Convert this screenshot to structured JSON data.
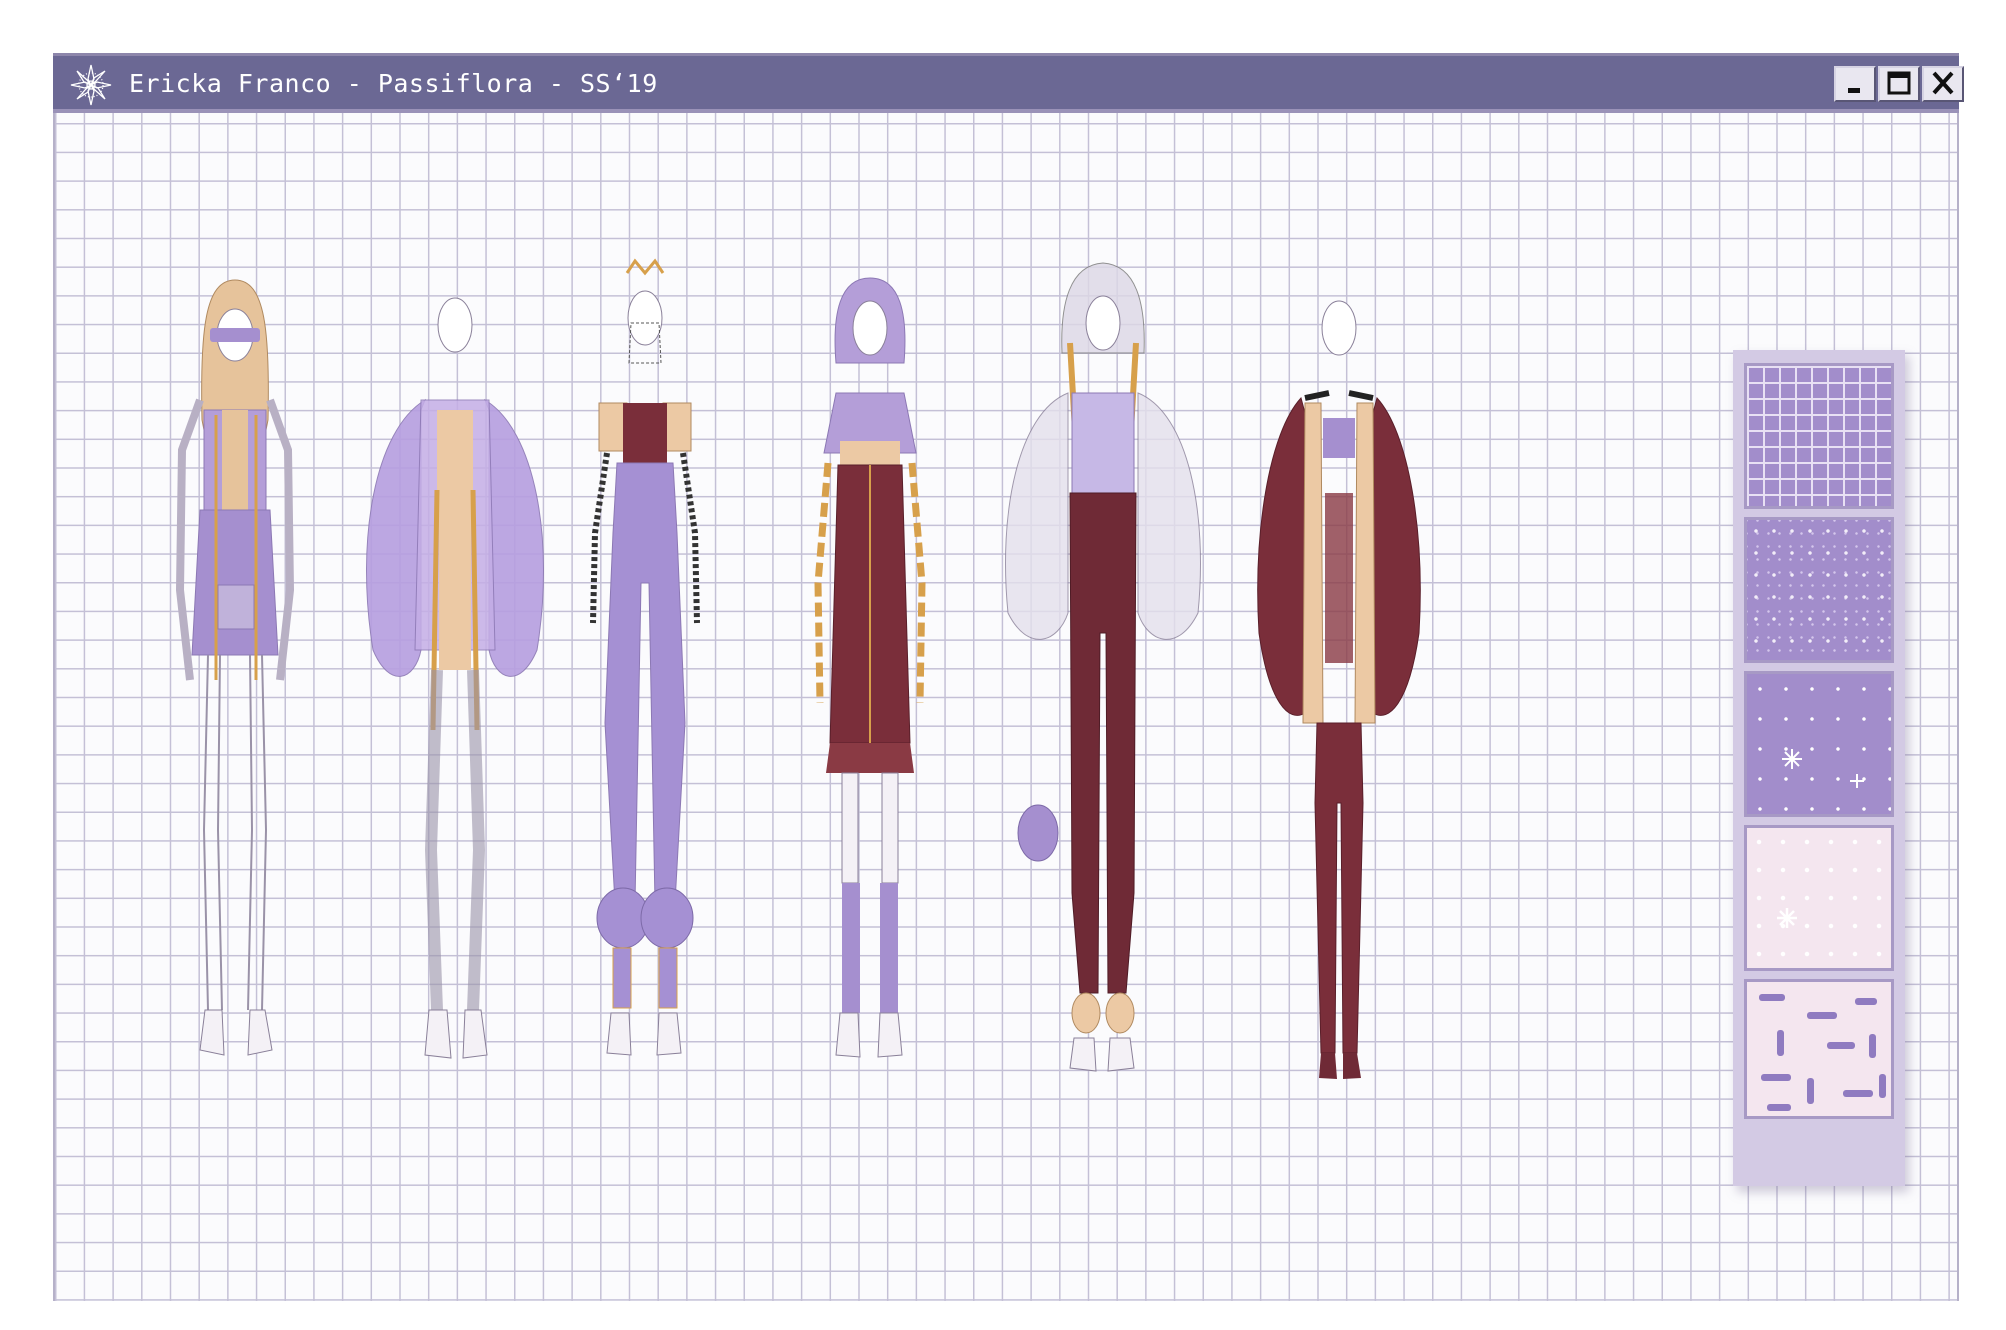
{
  "window": {
    "title": "Ericka Franco - Passiflora - SS‘19",
    "app_icon": "passionflower-icon",
    "controls": [
      "minimize-icon",
      "maximize-icon",
      "close-icon"
    ]
  },
  "colors": {
    "titlebar": "#6b6894",
    "grid_line": "#c4c0d6",
    "lavender": "#a58fcf",
    "lavender_light": "#c8b8e6",
    "burgundy": "#7a2e3a",
    "beige": "#ecc9a4",
    "gold": "#d7a04b",
    "blush": "#f4e6ef"
  },
  "figures": [
    {
      "name": "look-1-hooded-mini-dress"
    },
    {
      "name": "look-2-balloon-sleeve-coat"
    },
    {
      "name": "look-3-lavender-jumpsuit"
    },
    {
      "name": "look-4-hooded-burgundy-dress"
    },
    {
      "name": "look-5-sheer-hood-burgundy-trousers"
    },
    {
      "name": "look-6-burgundy-strap-coat"
    }
  ],
  "swatches": [
    {
      "name": "lattice-swatch"
    },
    {
      "name": "confetti-swatch"
    },
    {
      "name": "star-lavender-swatch"
    },
    {
      "name": "star-blush-swatch"
    },
    {
      "name": "dash-print-swatch"
    }
  ]
}
